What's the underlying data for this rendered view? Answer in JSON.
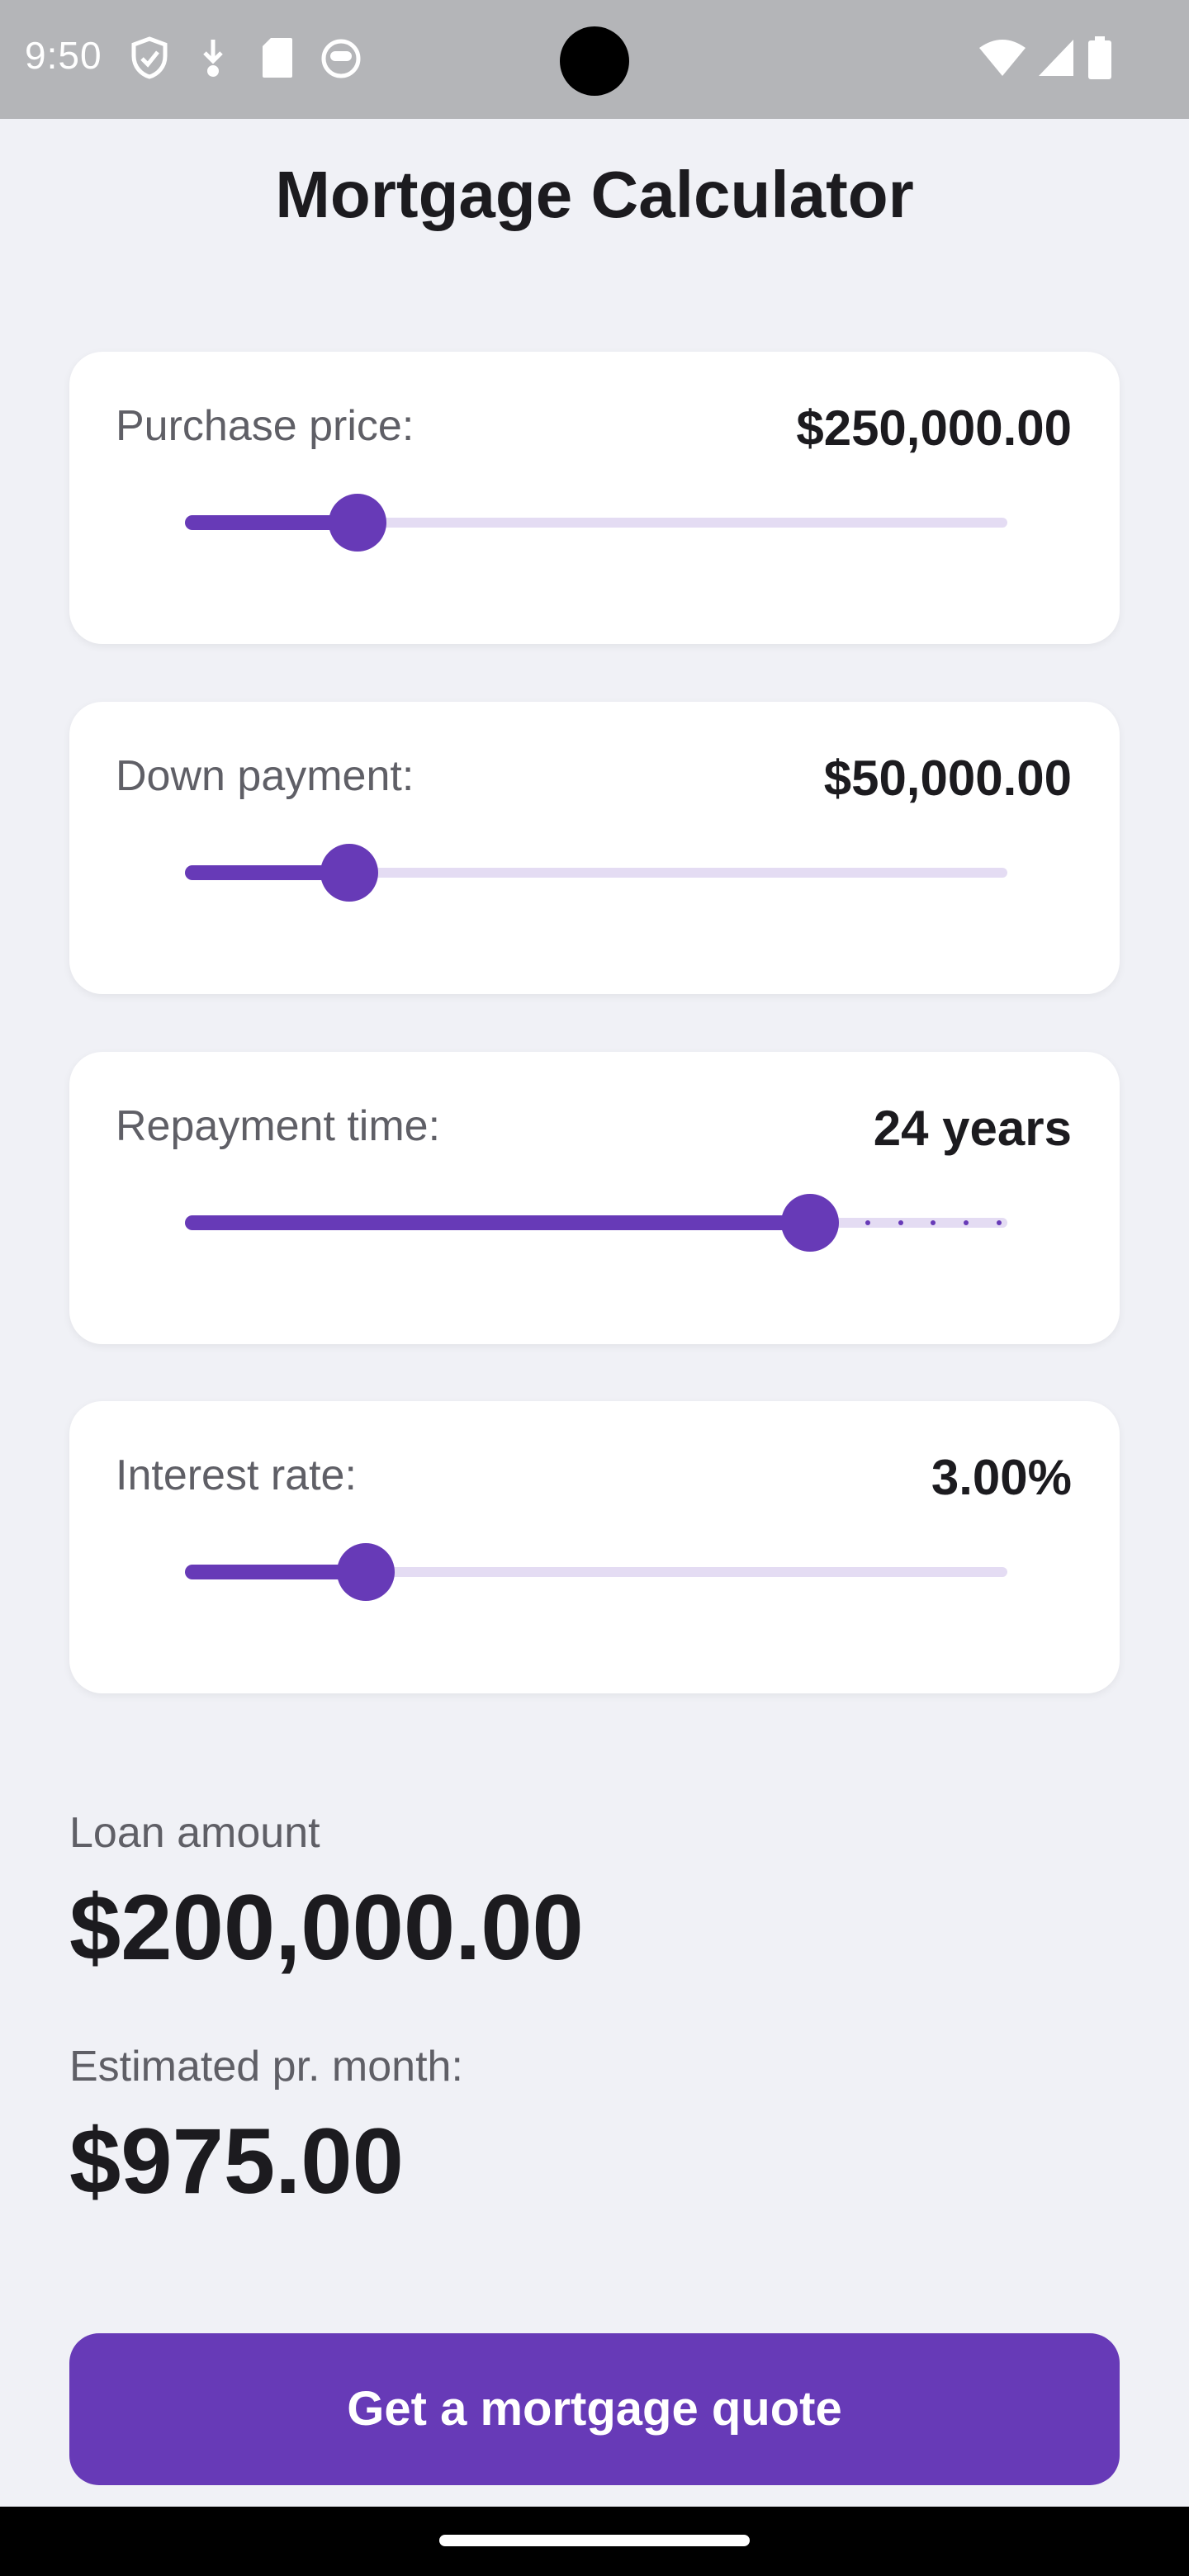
{
  "status_bar": {
    "time": "9:50",
    "left_icons": [
      "shield-icon",
      "download-icon",
      "sd-card-icon",
      "robot-face-icon"
    ],
    "right_icons": [
      "wifi-icon",
      "cell-signal-icon",
      "battery-icon"
    ]
  },
  "title": "Mortgage Calculator",
  "inputs": {
    "purchase": {
      "label": "Purchase price:",
      "value": "$250,000.00",
      "slider_fraction": 0.21
    },
    "down": {
      "label": "Down payment:",
      "value": "$50,000.00",
      "slider_fraction": 0.2
    },
    "repayment": {
      "label": "Repayment time:",
      "value": "24 years",
      "slider_fraction": 0.76,
      "discrete": true
    },
    "interest": {
      "label": "Interest rate:",
      "value": "3.00%",
      "slider_fraction": 0.22
    }
  },
  "results": {
    "loan_label": "Loan amount",
    "loan_value": "$200,000.00",
    "monthly_label": "Estimated pr. month:",
    "monthly_value": "$975.00"
  },
  "cta": {
    "label": "Get a mortgage quote"
  },
  "colors": {
    "accent": "#673ab7",
    "track": "#e4dcf3",
    "background": "#f0f1f6",
    "card": "#ffffff"
  }
}
